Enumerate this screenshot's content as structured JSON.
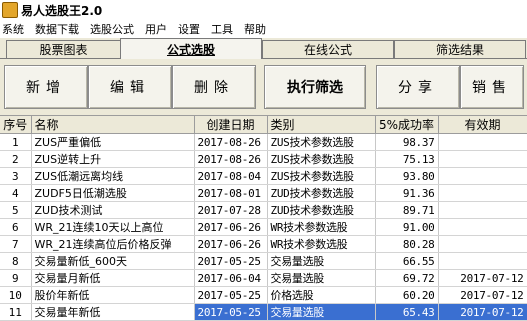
{
  "window": {
    "title": "易人选股王2.0"
  },
  "menu": [
    "系统",
    "数据下载",
    "选股公式",
    "用户",
    "设置",
    "工具",
    "帮助"
  ],
  "tabs": [
    {
      "label": "股票图表",
      "active": false
    },
    {
      "label": "公式选股",
      "active": true
    },
    {
      "label": "在线公式",
      "active": false
    },
    {
      "label": "筛选结果",
      "active": false
    }
  ],
  "toolbar": {
    "new_label": "新增",
    "edit_label": "编辑",
    "delete_label": "删除",
    "run_label": "执行筛选",
    "share_label": "分享",
    "sell_label": "销售"
  },
  "table": {
    "columns": [
      "序号",
      "名称",
      "创建日期",
      "类别",
      "5%成功率",
      "有效期"
    ],
    "rows": [
      {
        "idx": "1",
        "name": "ZUS严重偏低",
        "date": "2017-08-26",
        "category": "ZUS技术参数选股",
        "rate": "98.37",
        "expiry": ""
      },
      {
        "idx": "2",
        "name": "ZUS逆转上升",
        "date": "2017-08-26",
        "category": "ZUS技术参数选股",
        "rate": "75.13",
        "expiry": ""
      },
      {
        "idx": "3",
        "name": "ZUS低潮远离均线",
        "date": "2017-08-04",
        "category": "ZUS技术参数选股",
        "rate": "93.80",
        "expiry": ""
      },
      {
        "idx": "4",
        "name": "ZUDF5日低潮选股",
        "date": "2017-08-01",
        "category": "ZUD技术参数选股",
        "rate": "91.36",
        "expiry": ""
      },
      {
        "idx": "5",
        "name": "ZUD技术测试",
        "date": "2017-07-28",
        "category": "ZUD技术参数选股",
        "rate": "89.71",
        "expiry": ""
      },
      {
        "idx": "6",
        "name": "WR_21连续10天以上高位",
        "date": "2017-06-26",
        "category": "WR技术参数选股",
        "rate": "91.00",
        "expiry": ""
      },
      {
        "idx": "7",
        "name": "WR_21连续高位后价格反弹",
        "date": "2017-06-26",
        "category": "WR技术参数选股",
        "rate": "80.28",
        "expiry": ""
      },
      {
        "idx": "8",
        "name": "交易量新低_600天",
        "date": "2017-05-25",
        "category": "交易量选股",
        "rate": "66.55",
        "expiry": ""
      },
      {
        "idx": "9",
        "name": "交易量月新低",
        "date": "2017-06-04",
        "category": "交易量选股",
        "rate": "69.72",
        "expiry": "2017-07-12"
      },
      {
        "idx": "10",
        "name": "股价年新低",
        "date": "2017-05-25",
        "category": "价格选股",
        "rate": "60.20",
        "expiry": "2017-07-12"
      },
      {
        "idx": "11",
        "name": "交易量年新低",
        "date": "2017-05-25",
        "category": "交易量选股",
        "rate": "65.43",
        "expiry": "2017-07-12",
        "selected": true
      }
    ]
  }
}
